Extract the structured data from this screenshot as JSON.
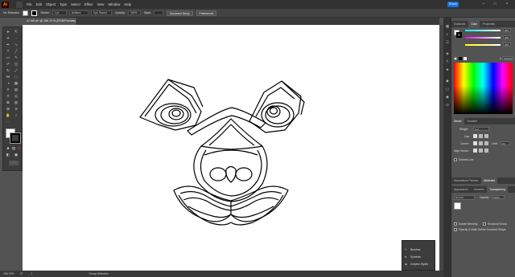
{
  "app": {
    "logo": "Ai"
  },
  "menubar": {
    "items": [
      "File",
      "Edit",
      "Object",
      "Type",
      "Select",
      "Effect",
      "View",
      "Window",
      "Help"
    ],
    "share_label": "Share",
    "window_controls": [
      "minimize-icon",
      "maximize-icon",
      "close-icon"
    ]
  },
  "controlbar": {
    "selection_label": "No Selection",
    "stroke_label": "Stroke:",
    "stroke_value": "1 pt",
    "uniform_label": "Uniform",
    "brush_label": "3 pt. Round",
    "opacity_label": "Opacity:",
    "opacity_value": "100%",
    "style_label": "Style:",
    "doc_setup_label": "Document Setup",
    "preferences_label": "Preferences"
  },
  "document_tab": {
    "title": "47.Ai5.ai* @ 196.79 % (RGB/Preview)",
    "close": "×"
  },
  "statusbar": {
    "zoom": "196.79%",
    "angle": "0°",
    "artboard": "1",
    "tool_name": "Group Selection"
  },
  "panels": {
    "top_tabs": [
      "Swatches",
      "Color",
      "Properties"
    ],
    "active_top_tab": "Color",
    "color": {
      "values": [
        "255",
        "255",
        "255"
      ],
      "hex_prefix": "#",
      "hex_value": "FFFFFF"
    },
    "stroke_tabs": [
      "Stroke",
      "Gradient"
    ],
    "active_stroke_tab": "Stroke",
    "stroke": {
      "weight_label": "Weight:",
      "weight_value": "1 pt",
      "cap_label": "Cap:",
      "corner_label": "Corner:",
      "limit_label": "Limit:",
      "limit_value": "10",
      "align_label": "Align Stroke:",
      "dashed_label": "Dashed Line"
    },
    "sep_tabs": [
      "Separations Preview",
      "Attributes"
    ],
    "active_sep_tab": "Attributes",
    "appearance_tabs": [
      "Appearance",
      "Libraries",
      "Transparency"
    ],
    "active_appearance_tab": "Transparency",
    "transparency": {
      "blend_mode": "Normal",
      "opacity_label": "Opacity:",
      "opacity_value": "100%",
      "isolate_label": "Isolate Blending",
      "knockout_label": "Knockout Group",
      "opacity_mask_label": "Opacity & Mask Define Knockout Shape"
    }
  },
  "libraries_popup": {
    "items": [
      {
        "label": "Brushes",
        "icon": "brush-icon"
      },
      {
        "label": "Symbols",
        "icon": "symbol-icon"
      },
      {
        "label": "Graphic Styles",
        "icon": "graphic-styles-icon"
      }
    ]
  },
  "colors": {
    "accent": "#1473e6",
    "canvas": "#ffffff",
    "workspace": "#535353"
  }
}
